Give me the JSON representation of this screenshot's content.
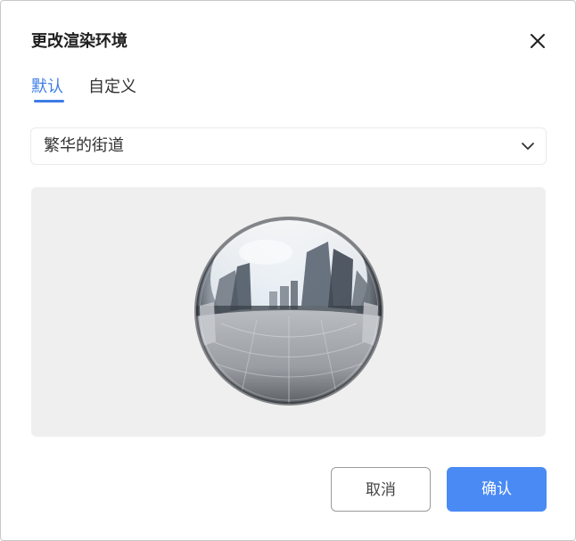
{
  "dialog": {
    "title": "更改渲染环境",
    "close_icon": "close-icon"
  },
  "tabs": [
    {
      "label": "默认",
      "active": true
    },
    {
      "label": "自定义",
      "active": false
    }
  ],
  "environment_select": {
    "value": "繁华的街道",
    "icon": "chevron-down-icon"
  },
  "preview": {
    "image": "chrome-sphere-street-reflection"
  },
  "buttons": {
    "cancel_label": "取消",
    "confirm_label": "确认"
  },
  "colors": {
    "accent": "#3d7de6",
    "primary_button": "#4a8af4",
    "preview_background": "#efefef"
  }
}
